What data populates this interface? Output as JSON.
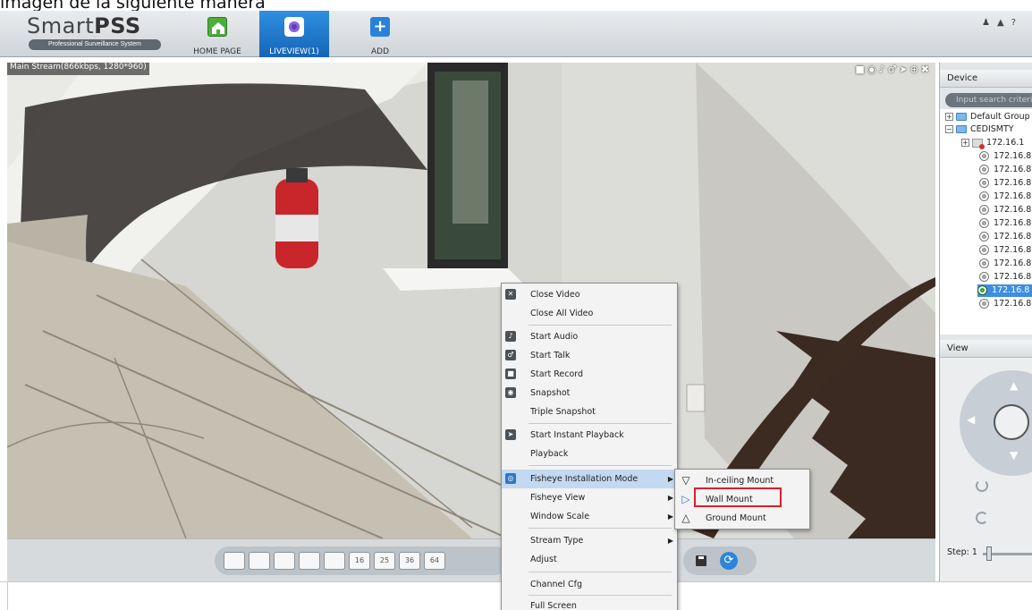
{
  "caption": "imagen de la siguiente manera",
  "app": {
    "brand_light": "Smart",
    "brand_bold": "PSS",
    "brand_sub": "Professional Surveillance System"
  },
  "nav": {
    "home_label": "HOME PAGE",
    "liveview_label": "LIVEVIEW(1)",
    "add_label": "ADD",
    "home_icon": "house-icon",
    "liveview_icon": "camera-icon",
    "add_icon": "plus-icon"
  },
  "video": {
    "stream_label": "Main Stream(866kbps, 1280*960)"
  },
  "layout_buttons": [
    "",
    "",
    "",
    "",
    "",
    "16",
    "25",
    "36",
    "64"
  ],
  "sidebar": {
    "device_title": "Device",
    "search_placeholder": "Input search criteria",
    "tree": [
      {
        "label": "Default Group",
        "kind": "group"
      },
      {
        "label": "CEDISMTY",
        "kind": "group"
      },
      {
        "label": "172.16.1",
        "kind": "dvr"
      },
      {
        "label": "172.16.8",
        "kind": "camera"
      },
      {
        "label": "172.16.8",
        "kind": "camera"
      },
      {
        "label": "172.16.8",
        "kind": "camera"
      },
      {
        "label": "172.16.8",
        "kind": "camera"
      },
      {
        "label": "172.16.8",
        "kind": "camera"
      },
      {
        "label": "172.16.8",
        "kind": "camera"
      },
      {
        "label": "172.16.8",
        "kind": "camera"
      },
      {
        "label": "172.16.8",
        "kind": "camera"
      },
      {
        "label": "172.16.8",
        "kind": "camera"
      },
      {
        "label": "172.16.8",
        "kind": "camera"
      },
      {
        "label": "172.16.8",
        "kind": "camera",
        "selected": true
      },
      {
        "label": "172.16.8",
        "kind": "camera"
      }
    ],
    "view_title": "View",
    "step_label": "Step:",
    "step_value": "1"
  },
  "context_menu": {
    "items": [
      {
        "label": "Close Video",
        "icon": "close-icon"
      },
      {
        "label": "Close All Video"
      },
      {
        "label": "Start Audio",
        "icon": "speaker-icon"
      },
      {
        "label": "Start Talk",
        "icon": "microphone-icon"
      },
      {
        "label": "Start Record",
        "icon": "record-icon"
      },
      {
        "label": "Snapshot",
        "icon": "snapshot-icon"
      },
      {
        "label": "Triple Snapshot"
      },
      {
        "label": "Start Instant Playback",
        "icon": "instant-playback-icon"
      },
      {
        "label": "Playback"
      },
      {
        "label": "Fisheye Installation Mode",
        "icon": "fisheye-icon",
        "submenu": true,
        "highlighted": true
      },
      {
        "label": "Fisheye View",
        "submenu": true
      },
      {
        "label": "Window Scale",
        "submenu": true
      },
      {
        "label": "Stream Type",
        "submenu": true
      },
      {
        "label": "Adjust"
      },
      {
        "label": "Channel Cfg"
      },
      {
        "label": "Full Screen"
      }
    ]
  },
  "submenu": {
    "items": [
      {
        "label": "In-ceiling Mount",
        "icon": "ceiling-mount-icon"
      },
      {
        "label": "Wall Mount",
        "icon": "wall-mount-icon",
        "checked": true
      },
      {
        "label": "Ground Mount",
        "icon": "ground-mount-icon"
      }
    ]
  },
  "colors": {
    "accent_blue": "#2b86db",
    "highlight_red": "#e11d2a",
    "menu_highlight": "#c2d9f1"
  }
}
